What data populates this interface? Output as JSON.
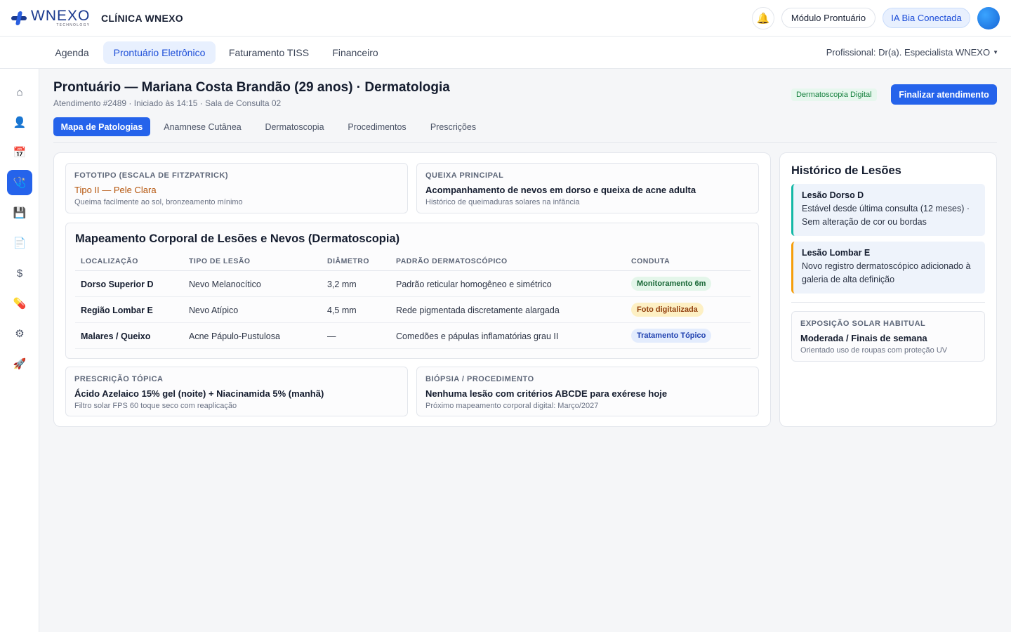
{
  "app": {
    "logo_word": "WNEXO",
    "logo_sub": "TECHNOLOGY",
    "clinic_name": "CLÍNICA WNEXO",
    "module_button": "Módulo Prontuário",
    "ia_button": "IA Bia Conectada",
    "bell_icon": "bell-icon",
    "accent_color": "#2563eb"
  },
  "nav": {
    "tabs": [
      {
        "label": "Agenda"
      },
      {
        "label": "Prontuário Eletrônico"
      },
      {
        "label": "Faturamento TISS"
      },
      {
        "label": "Financeiro"
      }
    ],
    "active_tab": "Prontuário Eletrônico",
    "professional": "Profissional: Dr(a). Especialista WNEXO"
  },
  "sidebar": {
    "items": [
      {
        "icon": "home-icon",
        "glyph": "⌂"
      },
      {
        "icon": "patient-icon",
        "glyph": "👤"
      },
      {
        "icon": "calendar-icon",
        "glyph": "📅"
      },
      {
        "icon": "records-icon",
        "glyph": "🩺"
      },
      {
        "icon": "save-icon",
        "glyph": "💾"
      },
      {
        "icon": "document-icon",
        "glyph": "📄"
      },
      {
        "icon": "dollar-icon",
        "glyph": "$"
      },
      {
        "icon": "pill-icon",
        "glyph": "💊"
      },
      {
        "icon": "gear-icon",
        "glyph": "⚙"
      },
      {
        "icon": "rocket-icon",
        "glyph": "🚀"
      }
    ]
  },
  "header": {
    "title": "Prontuário — Mariana Costa Brandão (29 anos) · Dermatologia",
    "subtitle": "Atendimento #2489 · Iniciado às 14:15 · Sala de Consulta 02",
    "badge": "Dermatoscopia Digital",
    "finish_button": "Finalizar atendimento"
  },
  "subtabs": [
    {
      "label": "Mapa de Patologias"
    },
    {
      "label": "Anamnese Cutânea"
    },
    {
      "label": "Dermatoscopia"
    },
    {
      "label": "Procedimentos"
    },
    {
      "label": "Prescrições"
    }
  ],
  "summary": {
    "fototipo": {
      "label": "FOTOTIPO (ESCALA DE FITZPATRICK)",
      "value": "Tipo II — Pele Clara",
      "note": "Queima facilmente ao sol, bronzeamento mínimo"
    },
    "queixa": {
      "label": "QUEIXA PRINCIPAL",
      "value": "Acompanhamento de nevos em dorso e queixa de acne adulta",
      "note": "Histórico de queimaduras solares na infância"
    }
  },
  "mapping": {
    "title": "Mapeamento Corporal de Lesões e Nevos (Dermatoscopia)",
    "columns": [
      "LOCALIZAÇÃO",
      "TIPO DE LESÃO",
      "DIÂMETRO",
      "PADRÃO DERMATOSCÓPICO",
      "CONDUTA"
    ],
    "rows": [
      {
        "location": "Dorso Superior D",
        "type": "Nevo Melanocítico",
        "diameter": "3,2 mm",
        "pattern": "Padrão reticular homogêneo e simétrico",
        "conduct": "Monitoramento 6m",
        "conduct_color": "#166534"
      },
      {
        "location": "Região Lombar E",
        "type": "Nevo Atípico",
        "diameter": "4,5 mm",
        "pattern": "Rede pigmentada discretamente alargada",
        "conduct": "Foto digitalizada",
        "conduct_color": "#92400e"
      },
      {
        "location": "Malares / Queixo",
        "type": "Acne Pápulo-Pustulosa",
        "diameter": "—",
        "pattern": "Comedões e pápulas inflamatórias grau II",
        "conduct": "Tratamento Tópico",
        "conduct_color": "#1e40af"
      }
    ]
  },
  "bottom": {
    "prescricao": {
      "label": "PRESCRIÇÃO TÓPICA",
      "value": "Ácido Azelaico 15% gel (noite) + Niacinamida 5% (manhã)",
      "note": "Filtro solar FPS 60 toque seco com reaplicação"
    },
    "biopsia": {
      "label": "BIÓPSIA / PROCEDIMENTO",
      "value": "Nenhuma lesão com critérios ABCDE para exérese hoje",
      "note": "Próximo mapeamento corporal digital: Março/2027"
    }
  },
  "history": {
    "title": "Histórico de Lesões",
    "items": [
      {
        "name": "Lesão Dorso D",
        "text": "Estável desde última consulta (12 meses) · Sem alteração de cor ou bordas",
        "accent": "#14b8a6"
      },
      {
        "name": "Lesão Lombar E",
        "text": "Novo registro dermatoscópico adicionado à galeria de alta definição",
        "accent": "#f59e0b"
      }
    ],
    "exposure": {
      "label": "EXPOSIÇÃO SOLAR HABITUAL",
      "value": "Moderada / Finais de semana",
      "note": "Orientado uso de roupas com proteção UV"
    }
  }
}
